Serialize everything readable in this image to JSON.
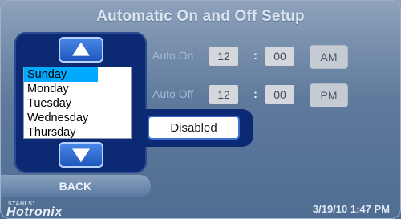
{
  "title": "Automatic On and Off Setup",
  "picker": {
    "up_icon": "up-arrow-icon",
    "down_icon": "down-arrow-icon",
    "days": [
      {
        "label": "Sunday",
        "selected": true
      },
      {
        "label": "Monday",
        "selected": false
      },
      {
        "label": "Tuesday",
        "selected": false
      },
      {
        "label": "Wednesday",
        "selected": false
      },
      {
        "label": "Thursday",
        "selected": false
      }
    ]
  },
  "auto_on": {
    "label": "Auto On",
    "hour": "12",
    "colon": ":",
    "minute": "00",
    "ampm": "AM"
  },
  "auto_off": {
    "label": "Auto Off",
    "hour": "12",
    "colon": ":",
    "minute": "00",
    "ampm": "PM"
  },
  "status_button": {
    "label": "Disabled"
  },
  "back_button": {
    "label": "BACK"
  },
  "footer": {
    "brand_small": "STAHLS'",
    "brand": "Hotronix",
    "datetime": "3/19/10  1:47 PM"
  },
  "colors": {
    "panel": "#0c2a73",
    "selected_day": "#00aaff",
    "label_blue": "#9fb9d7",
    "background": "#5f7a9c"
  }
}
